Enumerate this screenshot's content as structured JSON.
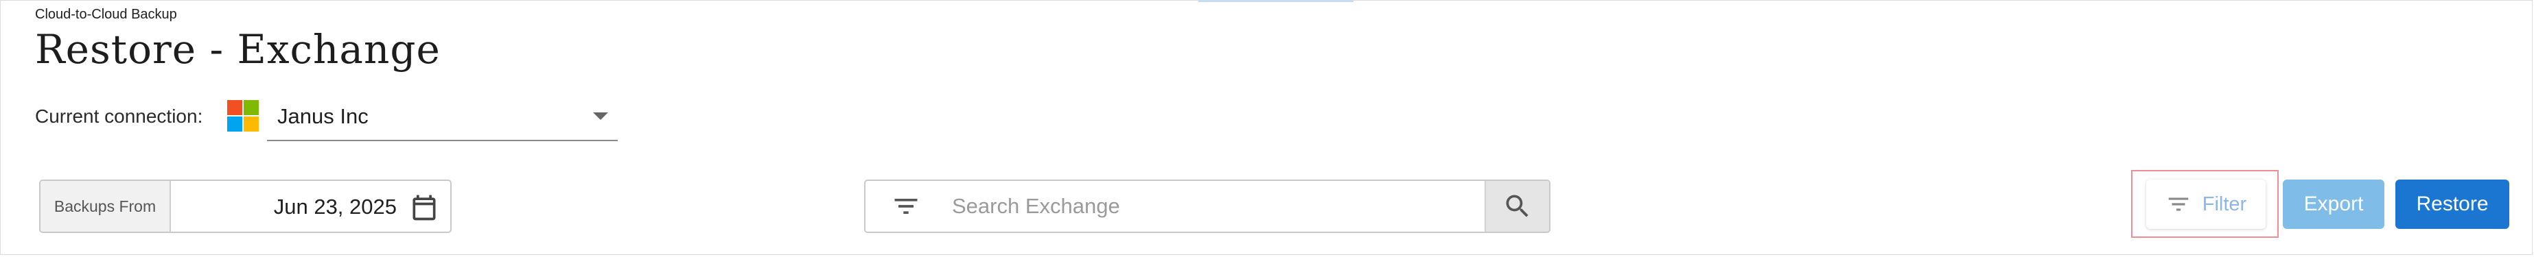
{
  "header": {
    "supertitle": "Cloud-to-Cloud Backup",
    "title": "Restore - Exchange"
  },
  "connection": {
    "label": "Current connection:",
    "value": "Janus Inc",
    "icon": "microsoft-logo",
    "logo_colors": [
      "#f25022",
      "#7fba00",
      "#00a4ef",
      "#ffb900"
    ]
  },
  "date_filter": {
    "label": "Backups From",
    "value": "Jun 23, 2025",
    "icon": "calendar-icon"
  },
  "search": {
    "placeholder": "Search Exchange",
    "filter_icon": "filter-lines-icon",
    "search_icon": "magnifier-icon"
  },
  "actions": {
    "filter_label": "Filter",
    "export_label": "Export",
    "restore_label": "Restore"
  },
  "colors": {
    "primary": "#1b76d1",
    "primary_disabled": "#7fbde8",
    "highlight_outline": "#f08c96"
  }
}
